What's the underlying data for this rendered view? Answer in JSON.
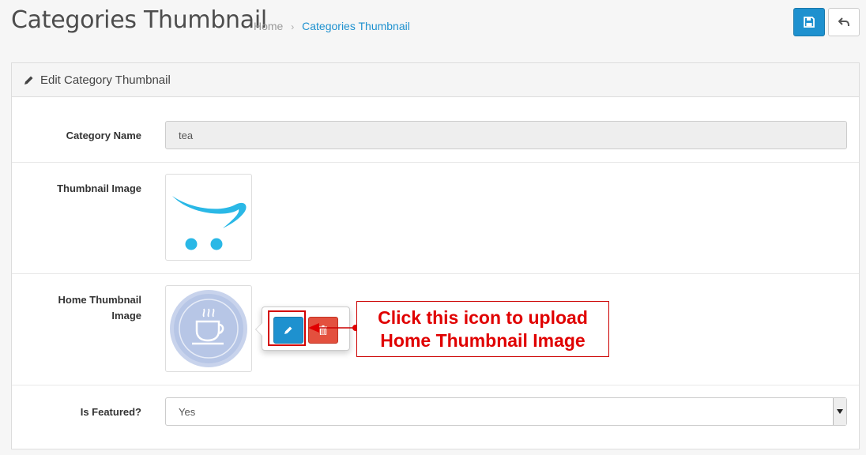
{
  "header": {
    "title": "Categories Thumbnail",
    "breadcrumb": {
      "home": "Home",
      "separator": "›",
      "current": "Categories Thumbnail"
    },
    "save_icon": "save-icon",
    "back_icon": "reply-icon"
  },
  "panel": {
    "heading": "Edit Category Thumbnail",
    "heading_icon": "pencil-icon"
  },
  "form": {
    "category_name": {
      "label": "Category Name",
      "value": "tea"
    },
    "thumbnail_image": {
      "label": "Thumbnail Image"
    },
    "home_thumbnail_image": {
      "label_line1": "Home Thumbnail",
      "label_line2": "Image"
    },
    "is_featured": {
      "label": "Is Featured?",
      "value": "Yes"
    }
  },
  "popover": {
    "edit_icon": "pencil-icon",
    "delete_icon": "trash-icon"
  },
  "annotation": {
    "line1": "Click this icon to upload",
    "line2": "Home Thumbnail Image"
  },
  "colors": {
    "primary": "#1e91cf",
    "danger": "#e3503e",
    "annotation": "#e00000",
    "thumb_logo": "#2ab8e6"
  }
}
